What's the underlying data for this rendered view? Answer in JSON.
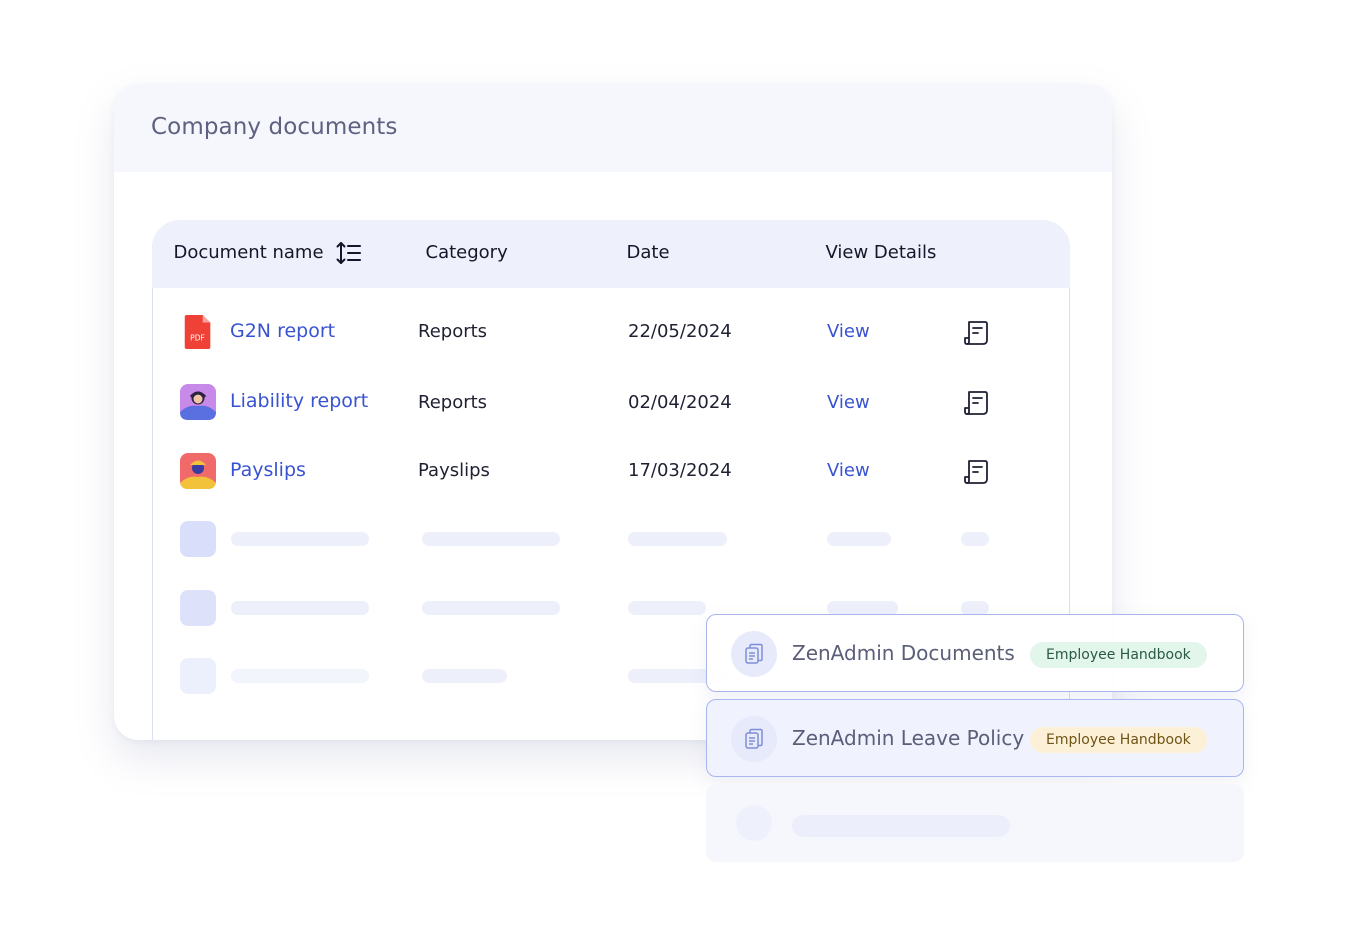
{
  "page": {
    "title": "Company documents"
  },
  "table": {
    "headers": {
      "document_name": "Document name",
      "category": "Category",
      "date": "Date",
      "view_details": "View Details"
    },
    "rows": [
      {
        "name": "G2N report",
        "category": "Reports",
        "date": "22/05/2024",
        "view": "View",
        "icon": "pdf-icon",
        "pdf_label": "PDF"
      },
      {
        "name": "Liability report",
        "category": "Reports",
        "date": "02/04/2024",
        "view": "View",
        "icon": "avatar-purple-icon"
      },
      {
        "name": "Payslips",
        "category": "Payslips",
        "date": "17/03/2024",
        "view": "View",
        "icon": "avatar-red-icon"
      }
    ]
  },
  "floating_cards": [
    {
      "title": "ZenAdmin Documents",
      "tag": "Employee Handbook",
      "tag_color": "#e3f6ec"
    },
    {
      "title": "ZenAdmin Leave Policy",
      "tag": "Employee Handbook",
      "tag_color": "#fcf1d7"
    }
  ],
  "colors": {
    "accent": "#3853d1",
    "header_bg": "#eef0fc",
    "title": "#5d6280"
  }
}
